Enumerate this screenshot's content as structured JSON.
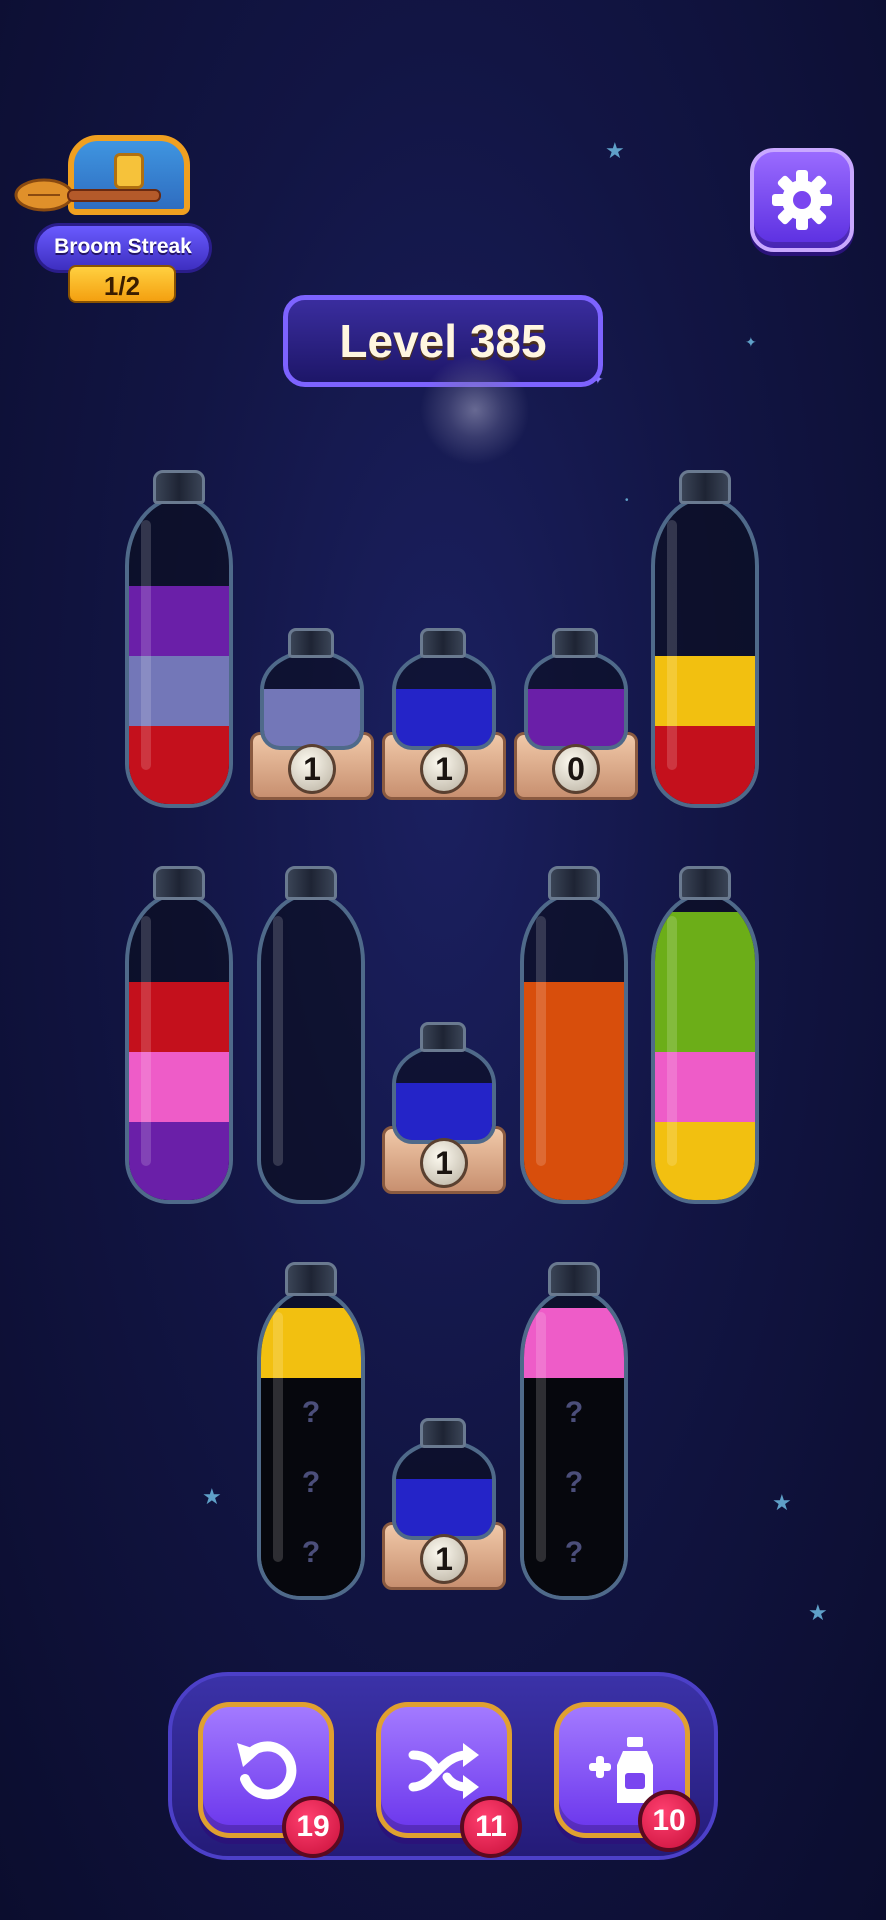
{
  "broom_streak": {
    "label": "Broom Streak",
    "count": "1/2"
  },
  "level": {
    "label": "Level 385"
  },
  "settings": {
    "icon": "gear-icon"
  },
  "colors": {
    "purple": "#6a1fa8",
    "lavender": "#7377b8",
    "red": "#c4101c",
    "yellow": "#f2c010",
    "blue": "#2424c8",
    "pink": "#ee5cc8",
    "orange": "#d84e0c",
    "green": "#6cae18"
  },
  "tubes": [
    {
      "row": 1,
      "type": "tall",
      "layers_top_to_bottom": [
        "purple",
        "lavender",
        "red"
      ]
    },
    {
      "row": 1,
      "type": "small",
      "liquid": "lavender",
      "counter": "1"
    },
    {
      "row": 1,
      "type": "small",
      "liquid": "blue",
      "counter": "1"
    },
    {
      "row": 1,
      "type": "small",
      "liquid": "purple",
      "counter": "0"
    },
    {
      "row": 1,
      "type": "tall",
      "layers_top_to_bottom": [
        "yellow",
        "red"
      ]
    },
    {
      "row": 2,
      "type": "tall",
      "layers_top_to_bottom": [
        "red",
        "pink",
        "purple"
      ]
    },
    {
      "row": 2,
      "type": "tall",
      "layers_top_to_bottom": []
    },
    {
      "row": 2,
      "type": "small",
      "liquid": "blue",
      "counter": "1"
    },
    {
      "row": 2,
      "type": "tall",
      "layers_top_to_bottom": [
        "orange",
        "orange",
        "orange"
      ]
    },
    {
      "row": 2,
      "type": "tall",
      "layers_top_to_bottom": [
        "green",
        "green",
        "pink",
        "yellow"
      ]
    },
    {
      "row": 3,
      "type": "tall",
      "layers_top_to_bottom": [
        "yellow",
        "?",
        "?",
        "?"
      ]
    },
    {
      "row": 3,
      "type": "small",
      "liquid": "blue",
      "counter": "1"
    },
    {
      "row": 3,
      "type": "tall",
      "layers_top_to_bottom": [
        "pink",
        "?",
        "?",
        "?"
      ]
    }
  ],
  "mystery_mark": "?",
  "powerups": [
    {
      "name": "undo",
      "icon": "undo-icon",
      "count": "19"
    },
    {
      "name": "shuffle",
      "icon": "shuffle-icon",
      "count": "11"
    },
    {
      "name": "add-bottle",
      "icon": "add-bottle-icon",
      "count": "10"
    }
  ]
}
